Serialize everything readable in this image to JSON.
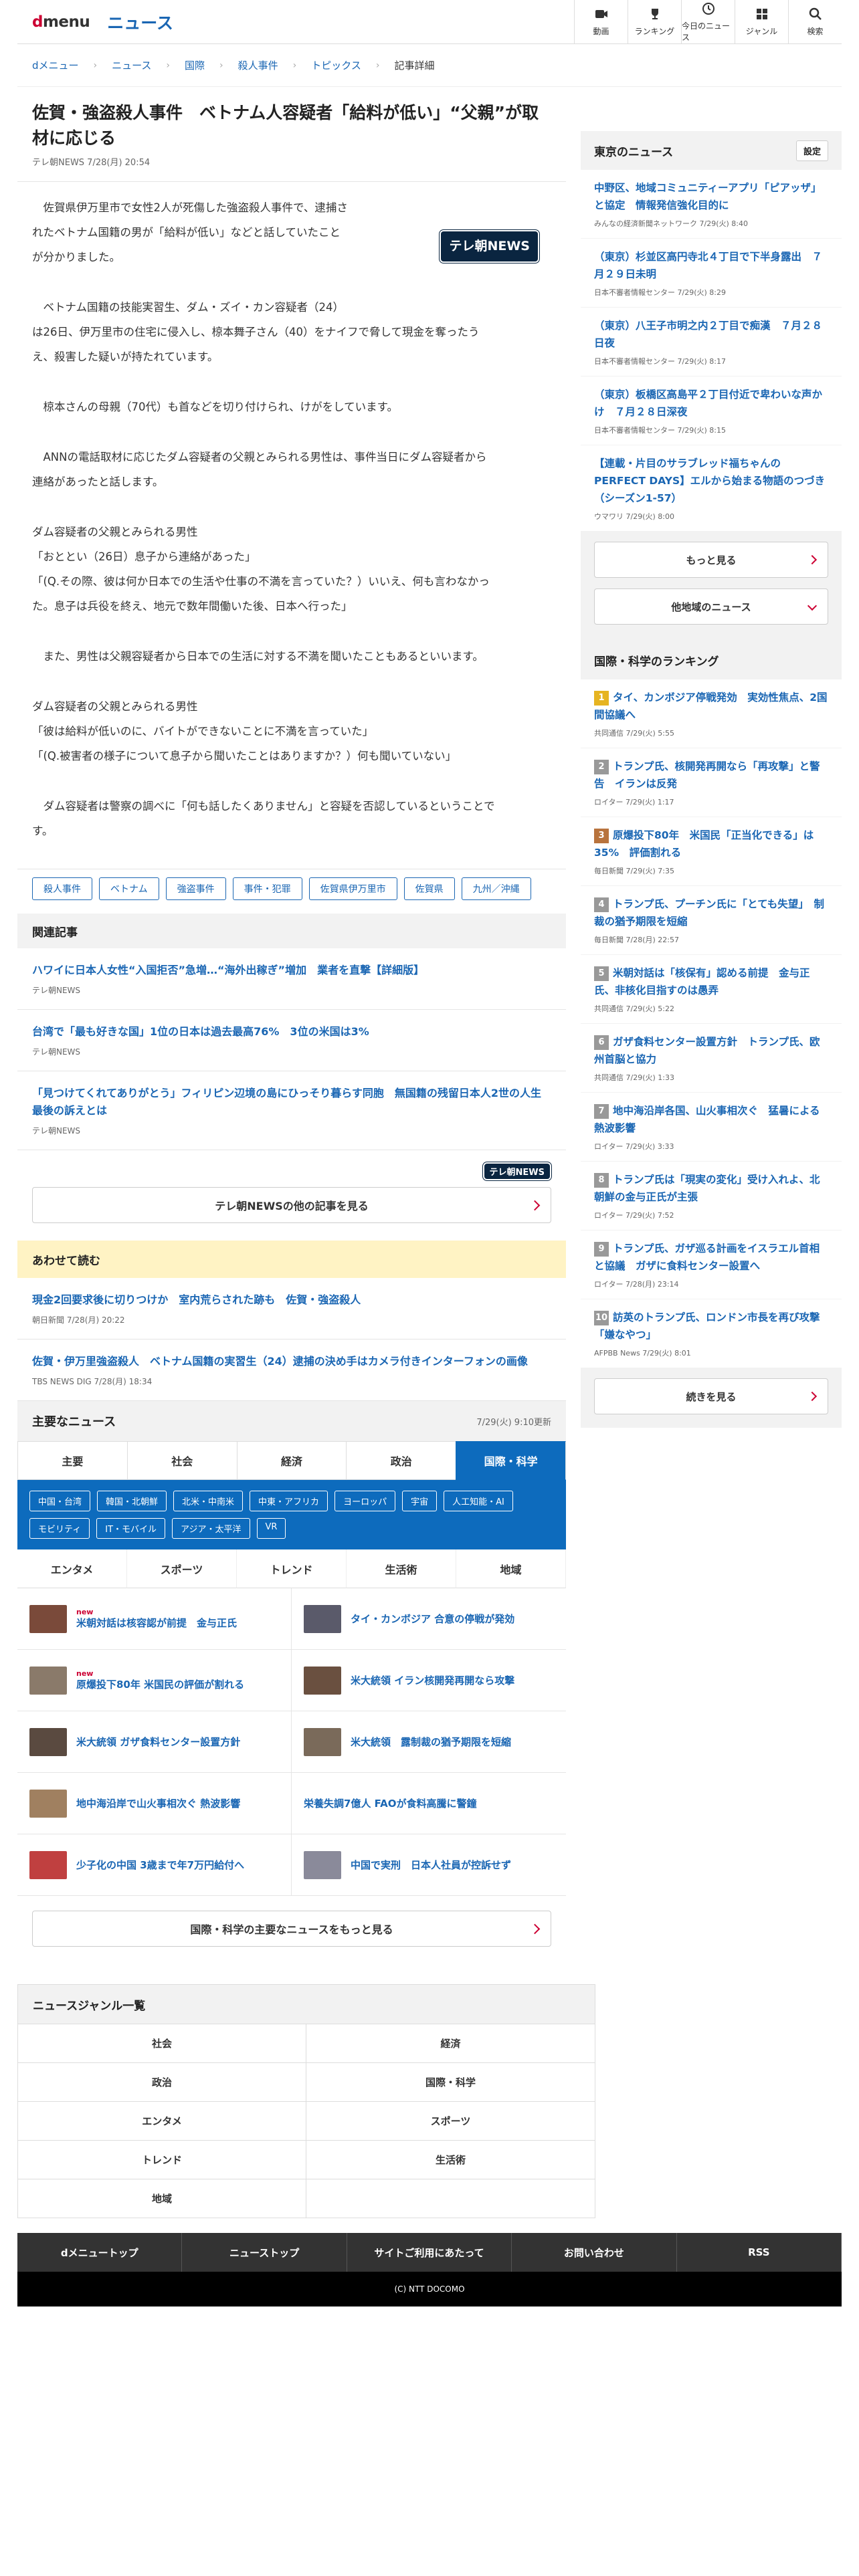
{
  "header": {
    "logo_d": "d",
    "logo_menu": "menu",
    "site": "ニュース",
    "nav": [
      {
        "label": "動画",
        "icon": "video-icon"
      },
      {
        "label": "ランキング",
        "icon": "trophy-icon"
      },
      {
        "label": "今日のニュース",
        "icon": "clock-icon"
      },
      {
        "label": "ジャンル",
        "icon": "grid-icon"
      },
      {
        "label": "検索",
        "icon": "search-icon"
      }
    ]
  },
  "breadcrumb": [
    "dメニュー",
    "ニュース",
    "国際",
    "殺人事件",
    "トピックス",
    "記事詳細"
  ],
  "article": {
    "title": "佐賀・強盗殺人事件　ベトナム人容疑者「給料が低い」“父親”が取材に応じる",
    "meta": "テレ朝NEWS 7/28(月) 20:54",
    "logo": "テレ朝NEWS",
    "paragraphs": [
      [
        "　佐賀県伊万里市で女性2人が死傷した強盗殺人事件で、逮捕さ",
        "れたベトナム国籍の男が「給料が低い」などと話していたこと",
        "が分かりました。"
      ],
      [
        "　ベトナム国籍の技能実習生、ダム・ズイ・カン容疑者（24）",
        "は26日、伊万里市の住宅に侵入し、椋本舞子さん（40）をナイフで脅して現金を奪ったう",
        "え、殺害した疑いが持たれています。"
      ],
      [
        "　椋本さんの母親（70代）も首などを切り付けられ、けがをしています。"
      ],
      [
        "　ANNの電話取材に応じたダム容疑者の父親とみられる男性は、事件当日にダム容疑者から",
        "連絡があったと話します。"
      ],
      [
        "ダム容疑者の父親とみられる男性",
        "「おととい（26日）息子から連絡があった」",
        "「(Q.その際、彼は何か日本での生活や仕事の不満を言っていた？）いいえ、何も言わなかっ",
        "た。息子は兵役を終え、地元で数年間働いた後、日本へ行った」"
      ],
      [
        "　また、男性は父親容疑者から日本での生活に対する不満を聞いたこともあるといいます。"
      ],
      [
        "ダム容疑者の父親とみられる男性",
        "「彼は給料が低いのに、バイトができないことに不満を言っていた」",
        "「(Q.被害者の様子について息子から聞いたことはありますか？）何も聞いていない」"
      ],
      [
        "　ダム容疑者は警察の調べに「何も話したくありません」と容疑を否認しているということで",
        "す。"
      ]
    ],
    "tags": [
      "殺人事件",
      "ベトナム",
      "強盗事件",
      "事件・犯罪",
      "佐賀県伊万里市",
      "佐賀県",
      "九州／沖縄"
    ]
  },
  "related": {
    "heading": "関連記事",
    "items": [
      {
        "title": "ハワイに日本人女性“入国拒否”急増…“海外出稼ぎ”増加　業者を直撃【詳細版】",
        "source": "テレ朝NEWS"
      },
      {
        "title": "台湾で「最も好きな国」1位の日本は過去最高76%　3位の米国は3%",
        "source": "テレ朝NEWS"
      },
      {
        "title": "「見つけてくれてありがとう」フィリピン辺境の島にひっそり暮らす同胞　無国籍の残留日本人2世の人生最後の訴えとは",
        "source": "テレ朝NEWS"
      }
    ],
    "logo": "テレ朝NEWS",
    "more": "テレ朝NEWSの他の記事を見る"
  },
  "also": {
    "heading": "あわせて読む",
    "items": [
      {
        "title": "現金2回要求後に切りつけか　室内荒らされた跡も　佐賀・強盗殺人",
        "source": "朝日新聞 7/28(月) 20:22"
      },
      {
        "title": "佐賀・伊万里強盗殺人　ベトナム国籍の実習生（24）逮捕の決め手はカメラ付きインターフォンの画像",
        "source": "TBS NEWS DIG 7/28(月) 18:34"
      }
    ]
  },
  "topnews": {
    "heading": "主要なニュース",
    "updated": "7/29(火) 9:10更新",
    "tabs": [
      "主要",
      "社会",
      "経済",
      "政治",
      "国際・科学"
    ],
    "subtabs": [
      "中国・台湾",
      "韓国・北朝鮮",
      "北米・中南米",
      "中東・アフリカ",
      "ヨーロッパ",
      "宇宙",
      "人工知能・AI",
      "モビリティ",
      "IT・モバイル",
      "アジア・太平洋",
      "VR"
    ],
    "tabs2": [
      "エンタメ",
      "スポーツ",
      "トレンド",
      "生活術",
      "地域"
    ],
    "items": [
      {
        "title": "米朝対話は核容認が前提　金与正氏",
        "new": "new",
        "color": "#7a4a3a"
      },
      {
        "title": "タイ・カンボジア 合意の停戦が発効",
        "new": "",
        "color": "#5a5a6a"
      },
      {
        "title": "原爆投下80年 米国民の評価が割れる",
        "new": "new",
        "color": "#8a7a6a"
      },
      {
        "title": "米大統領 イラン核開発再開なら攻撃",
        "new": "",
        "color": "#6a5040"
      },
      {
        "title": "米大統領 ガザ食料センター設置方針",
        "new": "",
        "color": "#5a4a40"
      },
      {
        "title": "米大統領　露制裁の猶予期限を短縮",
        "new": "",
        "color": "#7a6a5a"
      },
      {
        "title": "地中海沿岸で山火事相次ぐ 熱波影響",
        "new": "",
        "color": "#a08060"
      },
      {
        "title": "栄養失調7億人 FAOが食料高騰に警鐘",
        "new": "",
        "color": ""
      },
      {
        "title": "少子化の中国 3歳まで年7万円給付へ",
        "new": "",
        "color": "#c04040"
      },
      {
        "title": "中国で実刑　日本人社員が控訴せず",
        "new": "",
        "color": "#8a8a9a"
      }
    ],
    "more": "国際・科学の主要なニュースをもっと見る"
  },
  "side": {
    "heading": "東京のニュース",
    "setting": "設定",
    "items": [
      {
        "title": "中野区、地域コミュニティーアプリ「ピアッザ」と協定　情報発信強化目的に",
        "source": "みんなの経済新聞ネットワーク 7/29(火) 8:40"
      },
      {
        "title": "（東京）杉並区高円寺北４丁目で下半身露出　７月２９日未明",
        "source": "日本不審者情報センター 7/29(火) 8:29"
      },
      {
        "title": "（東京）八王子市明之内２丁目で痴漢　７月２８日夜",
        "source": "日本不審者情報センター 7/29(火) 8:17"
      },
      {
        "title": "（東京）板橋区高島平２丁目付近で卑わいな声かけ　７月２８日深夜",
        "source": "日本不審者情報センター 7/29(火) 8:15"
      },
      {
        "title": "【連載・片目のサラブレッド福ちゃんのPERFECT DAYS】エルから始まる物語のつづき（シーズン1-57）",
        "source": "ウマワリ 7/29(火) 8:00"
      }
    ],
    "more": "もっと見る",
    "other": "他地域のニュース",
    "ranking_heading": "国際・科学のランキング",
    "ranking": [
      {
        "n": "1",
        "title": "タイ、カンボジア停戦発効　実効性焦点、2国間協議へ",
        "source": "共同通信 7/29(火) 5:55",
        "color": "#e6b422"
      },
      {
        "n": "2",
        "title": "トランプ氏、核開発再開なら「再攻撃」と警告　イランは反発",
        "source": "ロイター 7/29(火) 1:17",
        "color": "#999999"
      },
      {
        "n": "3",
        "title": "原爆投下80年　米国民「正当化できる」は35%　評価割れる",
        "source": "毎日新聞 7/29(火) 7:35",
        "color": "#b8733d"
      },
      {
        "n": "4",
        "title": "トランプ氏、プーチン氏に「とても失望」　制裁の猶予期限を短縮",
        "source": "毎日新聞 7/28(月) 22:57",
        "color": "#999999"
      },
      {
        "n": "5",
        "title": "米朝対話は「核保有」認める前提　金与正氏、非核化目指すのは愚弄",
        "source": "共同通信 7/29(火) 5:22",
        "color": "#999999"
      },
      {
        "n": "6",
        "title": "ガザ食料センター設置方針　トランプ氏、欧州首脳と協力",
        "source": "共同通信 7/29(火) 1:33",
        "color": "#999999"
      },
      {
        "n": "7",
        "title": "地中海沿岸各国、山火事相次ぐ　猛暑による熱波影響",
        "source": "ロイター 7/29(火) 3:33",
        "color": "#999999"
      },
      {
        "n": "8",
        "title": "トランプ氏は「現実の変化」受け入れよ、北朝鮮の金与正氏が主張",
        "source": "ロイター 7/29(火) 7:52",
        "color": "#999999"
      },
      {
        "n": "9",
        "title": "トランプ氏、ガザ巡る計画をイスラエル首相と協議　ガザに食料センター設置へ",
        "source": "ロイター 7/28(月) 23:14",
        "color": "#999999"
      },
      {
        "n": "10",
        "title": "訪英のトランプ氏、ロンドン市長を再び攻撃「嫌なやつ」",
        "source": "AFPBB News 7/29(火) 8:01",
        "color": "#999999"
      }
    ],
    "ranking_more": "続きを見る"
  },
  "genre": {
    "heading": "ニュースジャンル一覧",
    "items": [
      "社会",
      "経済",
      "政治",
      "国際・科学",
      "エンタメ",
      "スポーツ",
      "トレンド",
      "生活術",
      "地域"
    ]
  },
  "footer": {
    "links": [
      "dメニュートップ",
      "ニューストップ",
      "サイトご利用にあたって",
      "お問い合わせ",
      "RSS"
    ],
    "copy": "(C) NTT DOCOMO"
  }
}
